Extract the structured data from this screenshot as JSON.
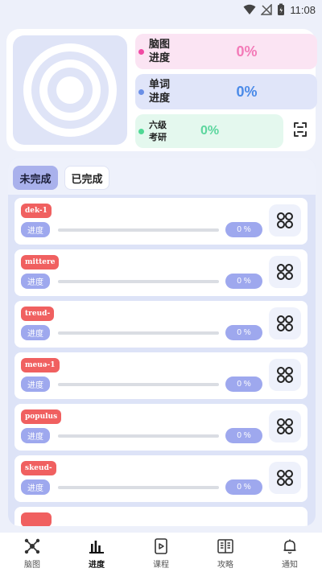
{
  "status_bar": {
    "time": "11:08"
  },
  "summary": {
    "mindmap": {
      "label": "脑图进度",
      "value": "0%",
      "color": "#f37ab8"
    },
    "words": {
      "label": "单词进度",
      "value": "0%",
      "color": "#4a8ae8"
    },
    "six_level": {
      "label": "六级考研",
      "value": "0%",
      "color": "#5cd69e"
    }
  },
  "tabs": {
    "incomplete": "未完成",
    "complete": "已完成"
  },
  "items": [
    {
      "tag": "dek-1",
      "progress_label": "进度",
      "percent": "0 %",
      "progress": 0
    },
    {
      "tag": "mittere",
      "progress_label": "进度",
      "percent": "0 %",
      "progress": 0
    },
    {
      "tag": "treud-",
      "progress_label": "进度",
      "percent": "0 %",
      "progress": 0
    },
    {
      "tag": "meuə-1",
      "progress_label": "进度",
      "percent": "0 %",
      "progress": 0
    },
    {
      "tag": "populus",
      "progress_label": "进度",
      "percent": "0 %",
      "progress": 0
    },
    {
      "tag": "skeud-",
      "progress_label": "进度",
      "percent": "0 %",
      "progress": 0
    }
  ],
  "nav": [
    {
      "label": "脑图",
      "icon": "mindmap-icon"
    },
    {
      "label": "进度",
      "icon": "bar-chart-icon",
      "active": true
    },
    {
      "label": "课程",
      "icon": "video-icon"
    },
    {
      "label": "攻略",
      "icon": "book-icon"
    },
    {
      "label": "通知",
      "icon": "bell-icon"
    }
  ],
  "colors": {
    "accent": "#9ea8ee",
    "tag": "#f06060",
    "panel": "#dde3f7"
  }
}
